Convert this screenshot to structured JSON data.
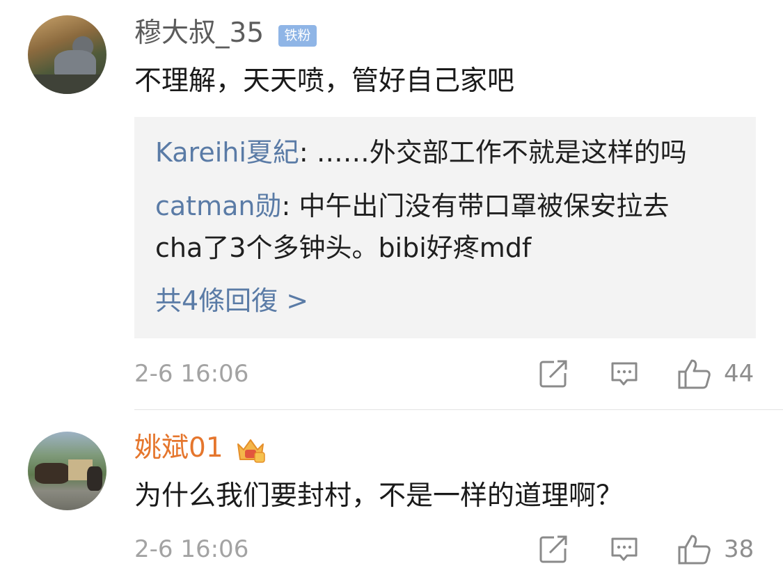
{
  "comments": [
    {
      "username": "穆大叔_35",
      "badge": "铁粉",
      "text": "不理解，天天喷，管好自己家吧",
      "replies": [
        {
          "name": "Kareihi夏紀",
          "sep": ": ",
          "text": "……外交部工作不就是这样的吗"
        },
        {
          "name": "catman勋",
          "sep": ": ",
          "text": "中午出门没有带口罩被保安拉去",
          "text_cont": "cha了3个多钟头。bibi好疼mdf"
        }
      ],
      "more_replies": "共4條回復 >",
      "time": "2-6 16:06",
      "likes": "44",
      "avatar_icon": "user-avatar"
    },
    {
      "username": "姚斌01",
      "badge_icon": "crown-icon",
      "text": "为什么我们要封村，不是一样的道理啊？",
      "time": "2-6 16:06",
      "likes": "38",
      "avatar_icon": "user-avatar"
    }
  ],
  "icons": {
    "share": "share-icon",
    "comment": "comment-icon",
    "like": "thumbs-up-icon"
  },
  "colors": {
    "username": "#5c5c5c",
    "vip_username": "#e5762d",
    "link": "#5a7ba6",
    "badge_bg": "#8fb5e6",
    "meta": "#a3a3a3",
    "reply_bg": "#f3f3f3"
  }
}
